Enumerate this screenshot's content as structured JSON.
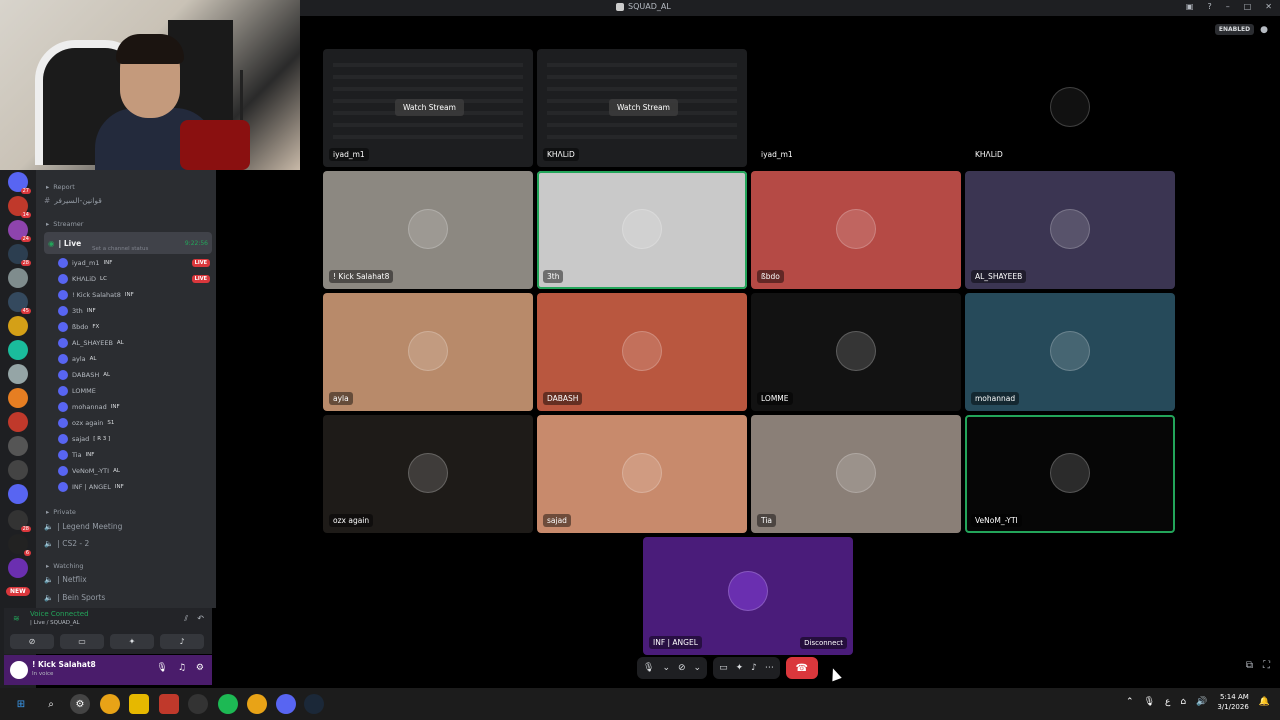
{
  "window": {
    "title": "SQUAD_AL",
    "enabled_badge": "ENABLED"
  },
  "sidebar": {
    "categories": {
      "report": "Report",
      "streamer": "Streamer",
      "private": "Private",
      "watching": "Watching"
    },
    "report_channel": "قوانين-السيرفر",
    "live_channel": {
      "name": "| Live",
      "status": "Set a channel status",
      "time": "9:22:56"
    },
    "voice_users": [
      {
        "name": "iyad_m1",
        "tag": "INF",
        "live": "LIVE"
      },
      {
        "name": "KHΛLiD",
        "tag": "LC",
        "live": "LIVE"
      },
      {
        "name": "! Kick Salahat8",
        "tag": "INF",
        "live": ""
      },
      {
        "name": "3th",
        "tag": "INF",
        "live": ""
      },
      {
        "name": "ßbdo",
        "tag": "FX",
        "live": ""
      },
      {
        "name": "AL_SHAYEEB",
        "tag": "AL",
        "live": ""
      },
      {
        "name": "ayla",
        "tag": "AL",
        "live": ""
      },
      {
        "name": "DABASH",
        "tag": "AL",
        "live": ""
      },
      {
        "name": "LOMME",
        "tag": "",
        "live": ""
      },
      {
        "name": "mohannad",
        "tag": "INF",
        "live": ""
      },
      {
        "name": "ozx again",
        "tag": "S1",
        "live": ""
      },
      {
        "name": "sajad",
        "tag": "[ R 3 ]",
        "live": ""
      },
      {
        "name": "Tia",
        "tag": "INF",
        "live": ""
      },
      {
        "name": "VeNoM_-YTI",
        "tag": "AL",
        "live": ""
      },
      {
        "name": "INF | ANGEL",
        "tag": "INF",
        "live": ""
      }
    ],
    "private_channels": [
      "| Legend Meeting",
      "| CS2 - 2"
    ],
    "watching_channels": [
      "| Netflix",
      "| Bein Sports"
    ],
    "voice_panel": {
      "status": "Voice Connected",
      "channel": "| Live / SQUAD_AL"
    },
    "user_panel": {
      "name": "! Kick Salahat8",
      "status": "In voice"
    },
    "new_badge": "NEW"
  },
  "grid": {
    "watch_label": "Watch Stream",
    "tiles": [
      {
        "name": "iyad_m1",
        "kind": "stream",
        "color": "#1d1e20"
      },
      {
        "name": "KHΛLiD",
        "kind": "stream",
        "color": "#1d1e20"
      },
      {
        "name": "iyad_m1",
        "kind": "empty",
        "color": "#000000"
      },
      {
        "name": "KHΛLiD",
        "kind": "empty",
        "color": "#000000"
      },
      {
        "name": "! Kick Salahat8",
        "kind": "avatar",
        "color": "#8c8881"
      },
      {
        "name": "3th",
        "kind": "avatar",
        "color": "#c9c9c9"
      },
      {
        "name": "ßbdo",
        "kind": "avatar",
        "color": "#b54a45"
      },
      {
        "name": "AL_SHAYEEB",
        "kind": "avatar",
        "color": "#3b3552"
      },
      {
        "name": "ayla",
        "kind": "avatar",
        "color": "#b88a6a"
      },
      {
        "name": "DABASH",
        "kind": "avatar",
        "color": "#b9573f"
      },
      {
        "name": "LOMME",
        "kind": "avatar",
        "color": "#121212"
      },
      {
        "name": "mohannad",
        "kind": "avatar",
        "color": "#264a5a"
      },
      {
        "name": "ozx again",
        "kind": "avatar",
        "color": "#1e1b18"
      },
      {
        "name": "sajad",
        "kind": "avatar",
        "color": "#c88a6c"
      },
      {
        "name": "Tia",
        "kind": "avatar",
        "color": "#8a7f77"
      },
      {
        "name": "VeNoM_-YTI",
        "kind": "avatar",
        "color": "#060606"
      }
    ],
    "bottom_tile": {
      "name": "INF | ANGEL",
      "color": "#4a1c7a",
      "disconnect": "Disconnect"
    }
  },
  "taskbar": {
    "time": "5:14 AM",
    "date": "3/1/2026"
  },
  "colors": {
    "accent": "#5865f2",
    "green": "#23a55a",
    "red": "#da373c"
  }
}
